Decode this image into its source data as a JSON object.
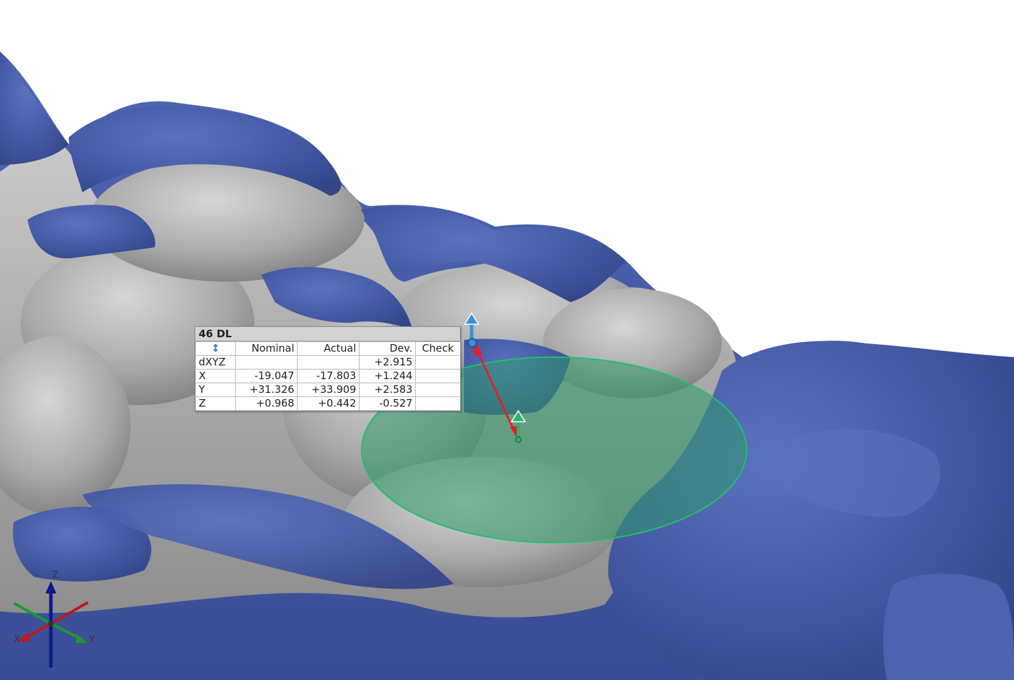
{
  "label": {
    "title": "46 DL",
    "header_icon": "sort-arrows-icon",
    "columns": [
      "Nominal",
      "Actual",
      "Dev.",
      "Check"
    ],
    "rows": [
      {
        "name": "dXYZ",
        "nominal": "",
        "actual": "",
        "dev": "+2.915",
        "check": ""
      },
      {
        "name": "X",
        "nominal": "-19.047",
        "actual": "-17.803",
        "dev": "+1.244",
        "check": ""
      },
      {
        "name": "Y",
        "nominal": "+31.326",
        "actual": "+33.909",
        "dev": "+2.583",
        "check": ""
      },
      {
        "name": "Z",
        "nominal": "+0.968",
        "actual": "+0.442",
        "dev": "-0.527",
        "check": ""
      }
    ]
  },
  "triad": {
    "x": "X",
    "y": "Y",
    "z": "Z"
  },
  "colors": {
    "cad_mesh": "#aeaeae",
    "scan_mesh": "#4a5fa8",
    "tolerance_disc": "#2f9a6a",
    "deviation_arrow": "#e0202a",
    "actual_point": "#3a8fd6",
    "nominal_point": "#2fb36a"
  }
}
